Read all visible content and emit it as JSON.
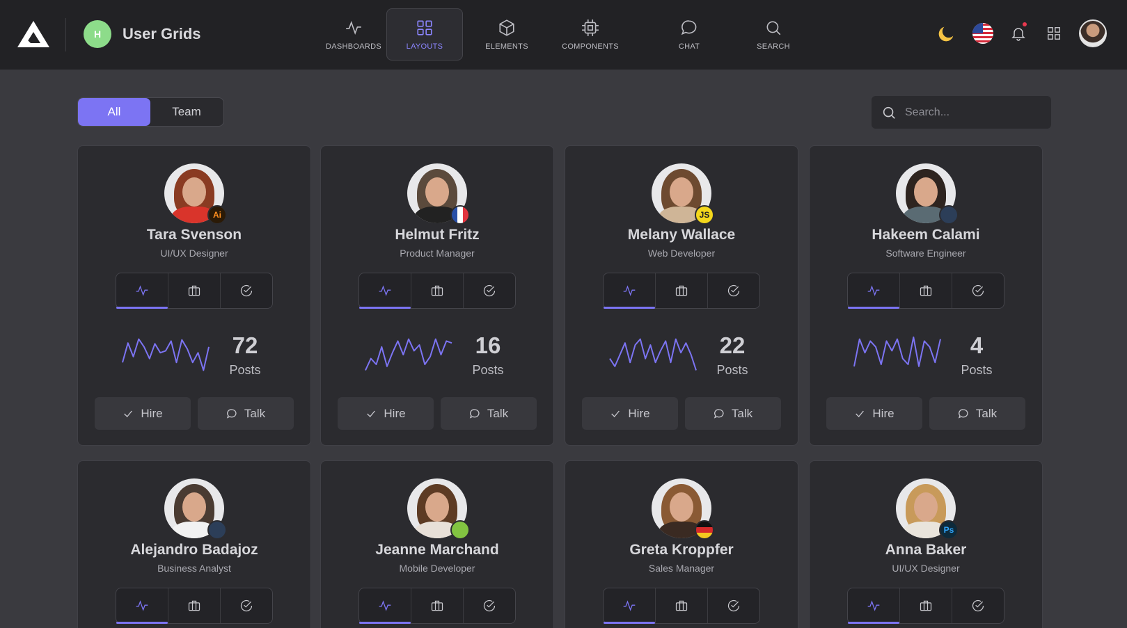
{
  "app": {
    "avatar_letter": "H",
    "title": "User Grids"
  },
  "nav": [
    {
      "label": "DASHBOARDS",
      "icon": "activity-icon",
      "active": false
    },
    {
      "label": "LAYOUTS",
      "icon": "grid-icon",
      "active": true
    },
    {
      "label": "ELEMENTS",
      "icon": "cube-icon",
      "active": false
    },
    {
      "label": "COMPONENTS",
      "icon": "cpu-icon",
      "active": false
    },
    {
      "label": "CHAT",
      "icon": "chat-icon",
      "active": false
    },
    {
      "label": "SEARCH",
      "icon": "search-icon",
      "active": false
    }
  ],
  "filter": {
    "all_label": "All",
    "team_label": "Team",
    "selected": "All"
  },
  "search": {
    "placeholder": "Search..."
  },
  "colors": {
    "accent": "#7c74f3",
    "card": "#2b2b2f",
    "background": "#3a3a3f",
    "topbar": "#222225",
    "notification": "#e8384f"
  },
  "buttons": {
    "hire_label": "Hire",
    "talk_label": "Talk",
    "posts_label": "Posts"
  },
  "users": [
    {
      "name": "Tara Svenson",
      "role": "UI/UX Designer",
      "posts": "72",
      "badge": "illustrator",
      "badge_text": "Ai",
      "spark": [
        30,
        80,
        45,
        90,
        70,
        40,
        78,
        55,
        60,
        85,
        30,
        88,
        65,
        30,
        55,
        10,
        70
      ]
    },
    {
      "name": "Helmut Fritz",
      "role": "Product Manager",
      "posts": "16",
      "badge": "flag-france",
      "badge_text": "",
      "spark": [
        10,
        40,
        25,
        70,
        20,
        55,
        85,
        50,
        90,
        60,
        75,
        25,
        45,
        90,
        50,
        85,
        80
      ]
    },
    {
      "name": "Melany Wallace",
      "role": "Web Developer",
      "posts": "22",
      "badge": "javascript",
      "badge_text": "JS",
      "spark": [
        40,
        20,
        50,
        80,
        30,
        75,
        90,
        40,
        75,
        30,
        60,
        85,
        30,
        90,
        55,
        80,
        50,
        10
      ]
    },
    {
      "name": "Hakeem Calami",
      "role": "Software Engineer",
      "posts": "4",
      "badge": "python",
      "badge_text": "",
      "spark": [
        20,
        90,
        55,
        85,
        70,
        25,
        85,
        60,
        90,
        40,
        25,
        95,
        20,
        85,
        70,
        30,
        90
      ]
    },
    {
      "name": "Alejandro Badajoz",
      "role": "Business Analyst",
      "posts": "",
      "badge": "python",
      "badge_text": ""
    },
    {
      "name": "Jeanne Marchand",
      "role": "Mobile Developer",
      "posts": "",
      "badge": "android",
      "badge_text": ""
    },
    {
      "name": "Greta Kroppfer",
      "role": "Sales Manager",
      "posts": "",
      "badge": "flag-germany",
      "badge_text": ""
    },
    {
      "name": "Anna Baker",
      "role": "UI/UX Designer",
      "posts": "",
      "badge": "photoshop",
      "badge_text": "Ps"
    }
  ]
}
